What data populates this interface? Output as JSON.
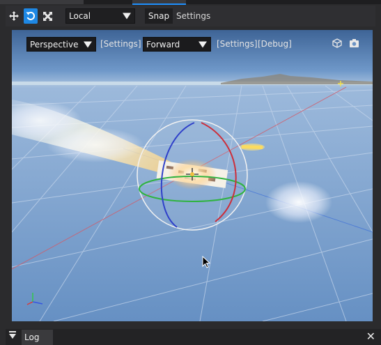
{
  "toolbar": {
    "space_mode": "Local",
    "snap_label": "Snap",
    "settings_label": "Settings"
  },
  "viewport": {
    "camera_mode": "Perspective",
    "camera_settings": "[Settings]",
    "view_mode": "Forward",
    "view_settings": "[Settings]",
    "debug": "[Debug]"
  },
  "log": {
    "tab_label": "Log"
  },
  "icons": {
    "move": "move-icon",
    "rotate": "rotate-icon",
    "scale": "scale-icon",
    "camera": "camera-icon",
    "cube": "cube-icon",
    "close": "close-icon"
  },
  "colors": {
    "accent": "#1e88e5",
    "sky": "#6b93c4"
  }
}
